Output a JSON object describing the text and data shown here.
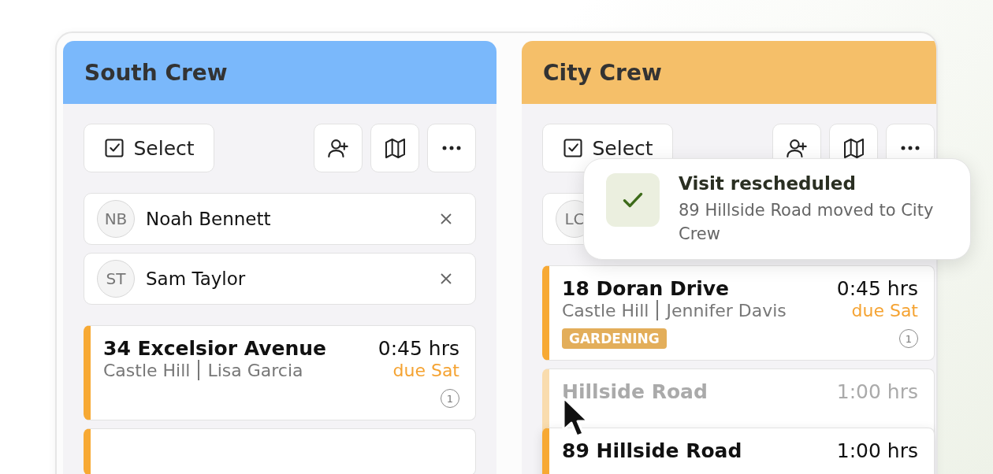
{
  "columns": [
    {
      "title": "South Crew",
      "color": "#7ab8fb",
      "select_label": "Select",
      "members": [
        {
          "initials": "NB",
          "name": "Noah Bennett"
        },
        {
          "initials": "ST",
          "name": "Sam Taylor"
        }
      ],
      "cards": [
        {
          "kind": "job",
          "title": "34 Excelsior Avenue",
          "duration": "0:45 hrs",
          "area": "Castle Hill",
          "client": "Lisa Garcia",
          "due": "due Sat",
          "count": "1"
        },
        {
          "kind": "clipped"
        }
      ]
    },
    {
      "title": "City Crew",
      "color": "#f5bf69",
      "select_label": "Select",
      "members": [
        {
          "initials": "LC"
        }
      ],
      "cards": [
        {
          "kind": "job",
          "title": "18 Doran Drive",
          "duration": "0:45 hrs",
          "area": "Castle Hill",
          "client": "Jennifer Davis",
          "due": "due Sat",
          "tag": "GARDENING",
          "count": "1"
        },
        {
          "kind": "ghost",
          "title": "Hillside Road",
          "duration": "1:00 hrs"
        },
        {
          "kind": "dragging",
          "title": "89 Hillside Road",
          "duration": "1:00 hrs"
        }
      ]
    }
  ],
  "toast": {
    "title": "Visit rescheduled",
    "message": "89 Hillside Road moved to City Crew"
  }
}
